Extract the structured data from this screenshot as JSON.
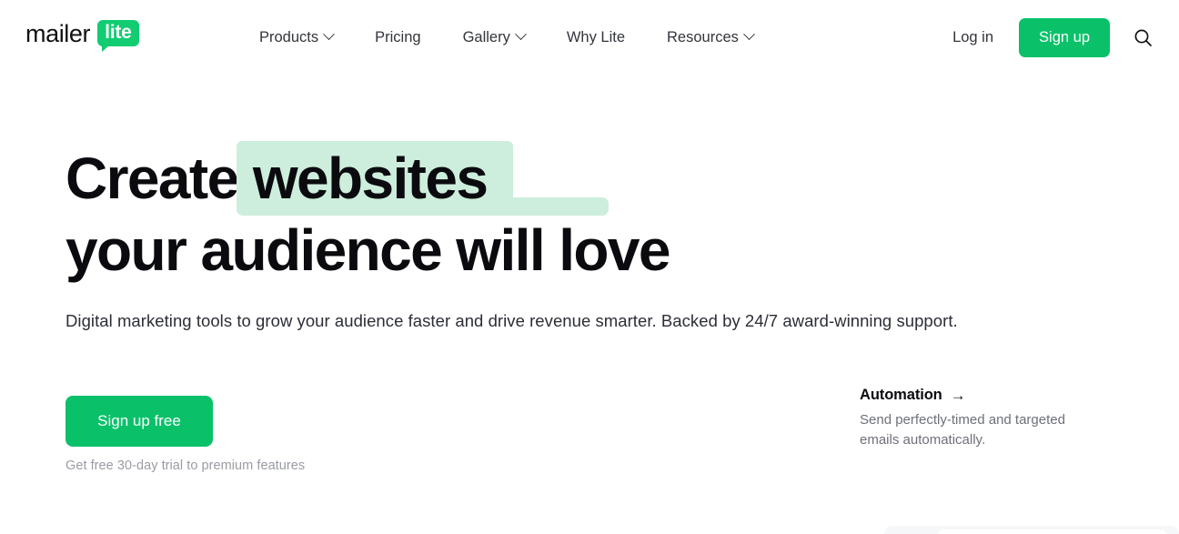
{
  "brand": {
    "name_primary": "mailer",
    "name_badge": "lite",
    "accent_green": "#0ac16a",
    "badge_green": "#12cc72",
    "mint_highlight": "#cdeedc"
  },
  "header": {
    "nav_items": [
      {
        "label": "Products",
        "has_dropdown": true
      },
      {
        "label": "Pricing",
        "has_dropdown": false
      },
      {
        "label": "Gallery",
        "has_dropdown": true
      },
      {
        "label": "Why Lite",
        "has_dropdown": false
      },
      {
        "label": "Resources",
        "has_dropdown": true
      }
    ],
    "login_label": "Log in",
    "signup_label": "Sign up",
    "search_icon": "search-icon"
  },
  "hero": {
    "headline_part1": "Create ",
    "headline_highlight": "websites",
    "headline_line2": "your audience will love",
    "subheading": "Digital marketing tools to grow your audience faster and drive revenue smarter. Backed by 24/7 award-winning support.",
    "cta_label": "Sign up free",
    "cta_note": "Get free 30-day trial to premium features"
  },
  "feature_card": {
    "title": "Automation",
    "arrow": "→",
    "description": "Send perfectly-timed and targeted emails automatically."
  }
}
